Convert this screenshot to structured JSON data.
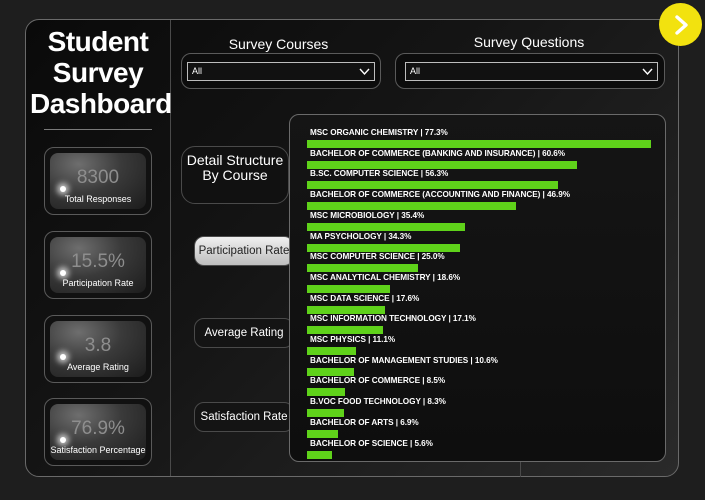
{
  "title": "Student Survey Dashboard",
  "kpis": [
    {
      "value": "8300",
      "label": "Total Responses"
    },
    {
      "value": "15.5%",
      "label": "Participation Rate"
    },
    {
      "value": "3.8",
      "label": "Average Rating"
    },
    {
      "value": "76.9%",
      "label": "Satisfaction Percentage"
    }
  ],
  "filters": {
    "courses": {
      "label": "Survey Courses",
      "value": "All"
    },
    "questions": {
      "label": "Survey Questions",
      "value": "All"
    }
  },
  "detail_button": "Detail Structure By Course",
  "nav": {
    "participation": "Participation Rate",
    "average": "Average Rating",
    "satisfaction": "Satisfaction Rate"
  },
  "stray_mark": "°",
  "colors": {
    "bar": "#5fd21a",
    "next_button": "#f2e20f"
  },
  "chart_data": {
    "type": "bar",
    "orientation": "horizontal",
    "categories": [
      "MSC ORGANIC CHEMISTRY",
      "BACHELOR OF COMMERCE (BANKING AND INSURANCE)",
      "B.SC. COMPUTER SCIENCE",
      "BACHELOR OF COMMERCE (ACCOUNTING AND FINANCE)",
      "MSC MICROBIOLOGY",
      "MA PSYCHOLOGY",
      "MSC COMPUTER SCIENCE",
      "MSC ANALYTICAL CHEMISTRY",
      "MSC DATA SCIENCE",
      "MSC INFORMATION TECHNOLOGY",
      "MSC PHYSICS",
      "BACHELOR OF MANAGEMENT STUDIES",
      "BACHELOR OF COMMERCE",
      "B.VOC FOOD TECHNOLOGY",
      "BACHELOR OF ARTS",
      "BACHELOR OF SCIENCE"
    ],
    "values": [
      77.3,
      60.6,
      56.3,
      46.9,
      35.4,
      34.3,
      25.0,
      18.6,
      17.6,
      17.1,
      11.1,
      10.6,
      8.5,
      8.3,
      6.9,
      5.6
    ],
    "value_labels": [
      "77.3%",
      "60.6%",
      "56.3%",
      "46.9%",
      "35.4%",
      "34.3%",
      "25.0%",
      "18.6%",
      "17.6%",
      "17.1%",
      "11.1%",
      "10.6%",
      "8.5%",
      "8.3%",
      "6.9%",
      "5.6%"
    ],
    "separator": "|",
    "max": 77.3
  }
}
